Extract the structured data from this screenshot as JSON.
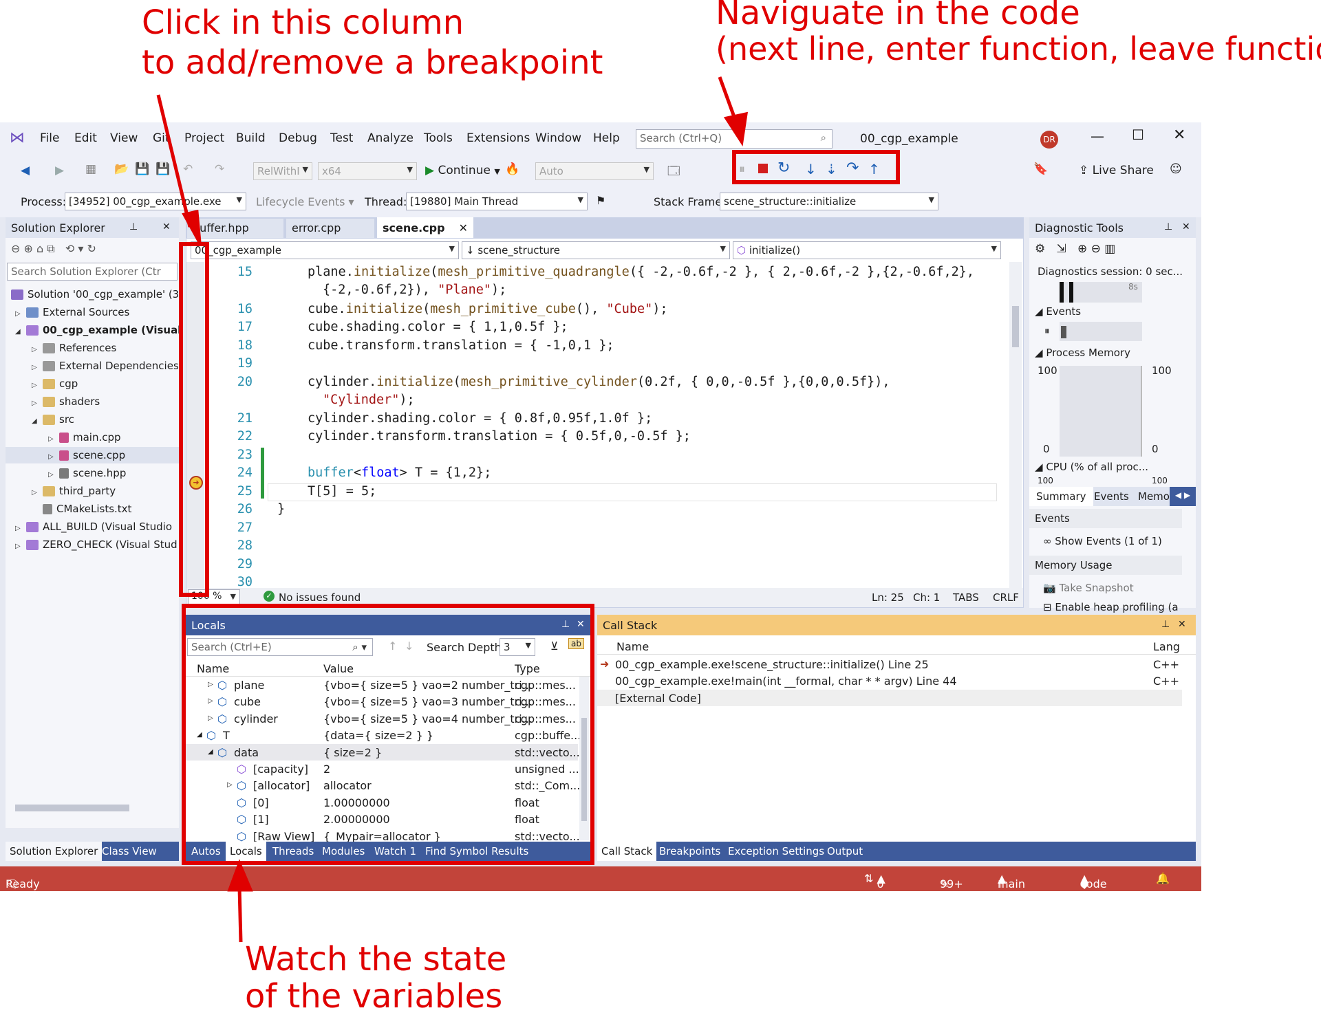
{
  "annotations": {
    "breakpoint": [
      "Click in this column",
      "to add/remove a breakpoint"
    ],
    "navigate": [
      "Naviguate in the code",
      "(next line, enter function, leave function)"
    ],
    "watch": [
      "Watch the state",
      "of the variables"
    ]
  },
  "colors": {
    "annotation_red": "#e00000",
    "status_bar": "#c2443a",
    "panel_dark": "#3e5b9c",
    "callstack_header": "#f5c97a"
  },
  "menu": {
    "items": [
      "File",
      "Edit",
      "View",
      "Git",
      "Project",
      "Build",
      "Debug",
      "Test",
      "Analyze",
      "Tools",
      "Extensions",
      "Window",
      "Help"
    ],
    "search_placeholder": "Search (Ctrl+Q)",
    "solution_title": "00_cgp_example",
    "avatar": "DR"
  },
  "toolbar": {
    "config": "RelWithI",
    "platform": "x64",
    "continue_label": "Continue",
    "auto": "Auto",
    "live_share": "Live Share"
  },
  "debugbar": {
    "process_label": "Process:",
    "process_value": "[34952] 00_cgp_example.exe",
    "lifecycle": "Lifecycle Events",
    "thread_label": "Thread:",
    "thread_value": "[19880] Main Thread",
    "stackframe_label": "Stack Frame:",
    "stackframe_value": "scene_structure::initialize"
  },
  "solution_explorer": {
    "title": "Solution Explorer",
    "search_placeholder": "Search Solution Explorer (Ctr",
    "items": [
      {
        "label": "Solution '00_cgp_example' (3"
      },
      {
        "label": "External Sources"
      },
      {
        "label": "00_cgp_example (Visual"
      },
      {
        "label": "References"
      },
      {
        "label": "External Dependencies"
      },
      {
        "label": "cgp"
      },
      {
        "label": "shaders"
      },
      {
        "label": "src"
      },
      {
        "label": "main.cpp"
      },
      {
        "label": "scene.cpp"
      },
      {
        "label": "scene.hpp"
      },
      {
        "label": "third_party"
      },
      {
        "label": "CMakeLists.txt"
      },
      {
        "label": "ALL_BUILD (Visual Studio"
      },
      {
        "label": "ZERO_CHECK (Visual Stud"
      }
    ],
    "tabs": [
      "Solution Explorer",
      "Class View"
    ]
  },
  "editor": {
    "tabs": [
      "buffer.hpp",
      "error.cpp",
      "scene.cpp"
    ],
    "nav_project": "00_cgp_example",
    "nav_scope": "scene_structure",
    "nav_member": "initialize()",
    "zoom": "100 %",
    "issues": "No issues found",
    "ln": "Ln: 25",
    "ch": "Ch: 1",
    "tabs_mode": "TABS",
    "eol": "CRLF",
    "line_numbers": [
      "15",
      "16",
      "17",
      "18",
      "19",
      "20",
      "21",
      "22",
      "23",
      "24",
      "25",
      "26",
      "27",
      "28",
      "29",
      "30"
    ]
  },
  "diagnostics": {
    "title": "Diagnostic Tools",
    "session": "Diagnostics session: 0 sec...",
    "tick": "8s",
    "events": "Events",
    "process_memory": "Process Memory",
    "mem_top_left": "100",
    "mem_top_right": "100",
    "mem_bottom_left": "0",
    "mem_bottom_right": "0",
    "cpu": "CPU (% of all proc...",
    "cpu_left": "100",
    "cpu_right": "100",
    "tabs": [
      "Summary",
      "Events",
      "Memo"
    ],
    "events_header": "Events",
    "show_events": "Show Events (1 of 1)",
    "memory_usage": "Memory Usage",
    "take_snapshot": "Take Snapshot",
    "heap_profiling": "Enable heap profiling (a"
  },
  "locals": {
    "title": "Locals",
    "search_placeholder": "Search (Ctrl+E)",
    "search_depth_label": "Search Depth:",
    "search_depth": "3",
    "columns": [
      "Name",
      "Value",
      "Type"
    ],
    "rows": [
      {
        "name": "plane",
        "value": "{vbo={ size=5 } vao=2 number_tri...",
        "type": "cgp::mes..."
      },
      {
        "name": "cube",
        "value": "{vbo={ size=5 } vao=3 number_tri...",
        "type": "cgp::mes..."
      },
      {
        "name": "cylinder",
        "value": "{vbo={ size=5 } vao=4 number_tri...",
        "type": "cgp::mes..."
      },
      {
        "name": "T",
        "value": "{data={ size=2 } }",
        "type": "cgp::buffe..."
      },
      {
        "name": "data",
        "value": "{ size=2 }",
        "type": "std::vecto..."
      },
      {
        "name": "[capacity]",
        "value": "2",
        "type": "unsigned ..."
      },
      {
        "name": "[allocator]",
        "value": "allocator",
        "type": "std::_Com..."
      },
      {
        "name": "[0]",
        "value": "1.00000000",
        "type": "float"
      },
      {
        "name": "[1]",
        "value": "2.00000000",
        "type": "float"
      },
      {
        "name": "[Raw View]",
        "value": "{_Mypair=allocator }",
        "type": "std::vecto..."
      }
    ],
    "tabs": [
      "Autos",
      "Locals",
      "Threads",
      "Modules",
      "Watch 1",
      "Find Symbol Results"
    ]
  },
  "callstack": {
    "title": "Call Stack",
    "columns": [
      "Name",
      "Lang"
    ],
    "rows": [
      {
        "name": "00_cgp_example.exe!scene_structure::initialize() Line 25",
        "lang": "C++"
      },
      {
        "name": "00_cgp_example.exe!main(int __formal, char * * argv) Line 44",
        "lang": "C++"
      },
      {
        "name": "[External Code]",
        "lang": ""
      }
    ],
    "tabs": [
      "Call Stack",
      "Breakpoints",
      "Exception Settings",
      "Output"
    ]
  },
  "statusbar": {
    "ready": "Ready",
    "sync": "0 / 0",
    "edits": "99+",
    "branch": "main",
    "repo": "code"
  }
}
